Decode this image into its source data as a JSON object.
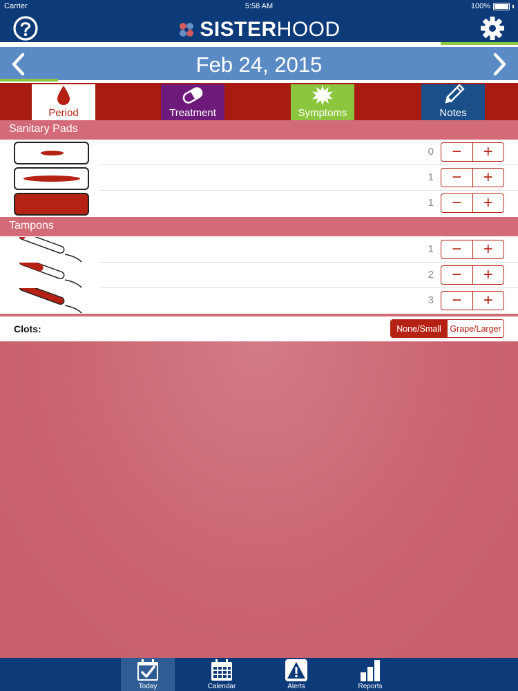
{
  "status_bar": {
    "carrier": "Carrier",
    "time": "5:58 AM",
    "battery": "100%"
  },
  "header": {
    "logo_bold": "SISTER",
    "logo_light": "HOOD",
    "help_icon": "question-circle-icon",
    "settings_icon": "gear-icon"
  },
  "date_bar": {
    "date": "Feb 24, 2015",
    "prev_icon": "chevron-left-icon",
    "next_icon": "chevron-right-icon"
  },
  "tabs": [
    {
      "label": "Period",
      "icon": "blood-drop-icon",
      "color": "#ffffff"
    },
    {
      "label": "Treatment",
      "icon": "pill-icon",
      "color": "#6e1a7a"
    },
    {
      "label": "Symptoms",
      "icon": "starburst-icon",
      "color": "#8cc63f"
    },
    {
      "label": "Notes",
      "icon": "pencil-icon",
      "color": "#1a4f8a"
    }
  ],
  "sanitary_pads": {
    "title": "Sanitary Pads",
    "rows": [
      {
        "icon": "pad-light-icon",
        "count": "0"
      },
      {
        "icon": "pad-medium-icon",
        "count": "1"
      },
      {
        "icon": "pad-heavy-icon",
        "count": "1"
      }
    ]
  },
  "tampons": {
    "title": "Tampons",
    "rows": [
      {
        "icon": "tampon-light-icon",
        "count": "1"
      },
      {
        "icon": "tampon-medium-icon",
        "count": "2"
      },
      {
        "icon": "tampon-heavy-icon",
        "count": "3"
      }
    ]
  },
  "stepper": {
    "minus": "−",
    "plus": "+"
  },
  "clots": {
    "label": "Clots:",
    "options": [
      "None/Small",
      "Grape/Larger"
    ],
    "selected": "None/Small"
  },
  "tabbar": [
    {
      "label": "Today",
      "icon": "calendar-check-icon"
    },
    {
      "label": "Calendar",
      "icon": "calendar-grid-icon"
    },
    {
      "label": "Alerts",
      "icon": "alert-icon"
    },
    {
      "label": "Reports",
      "icon": "bar-chart-icon"
    }
  ],
  "colors": {
    "brand_navy": "#0d3a78",
    "accent_red": "#b52214",
    "date_blue": "#5a8bc4",
    "section_pink": "#d26a77"
  }
}
